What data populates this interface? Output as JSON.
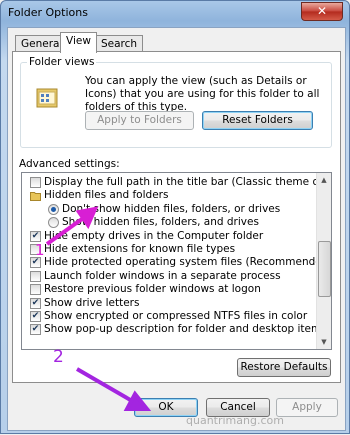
{
  "window": {
    "title": "Folder Options",
    "close_glyph": "✕"
  },
  "tabs": [
    {
      "label": "General"
    },
    {
      "label": "View"
    },
    {
      "label": "Search"
    }
  ],
  "folder_views": {
    "legend": "Folder views",
    "description": "You can apply the view (such as Details or Icons) that you are using for this folder to all folders of this type.",
    "apply_button": "Apply to Folders",
    "reset_button": "Reset Folders"
  },
  "advanced": {
    "label": "Advanced settings:",
    "items": [
      {
        "text": "Display the full path in the title bar (Classic theme only)",
        "kind": "checkbox",
        "checked": false,
        "indent": 1
      },
      {
        "text": "Hidden files and folders",
        "kind": "folder",
        "indent": 1
      },
      {
        "text": "Don't show hidden files, folders, or drives",
        "kind": "radio",
        "checked": true,
        "indent": 2
      },
      {
        "text": "Show hidden files, folders, and drives",
        "kind": "radio",
        "checked": false,
        "indent": 2
      },
      {
        "text": "Hide empty drives in the Computer folder",
        "kind": "checkbox",
        "checked": true,
        "indent": 1
      },
      {
        "text": "Hide extensions for known file types",
        "kind": "checkbox",
        "checked": false,
        "indent": 1
      },
      {
        "text": "Hide protected operating system files (Recommended)",
        "kind": "checkbox",
        "checked": true,
        "indent": 1
      },
      {
        "text": "Launch folder windows in a separate process",
        "kind": "checkbox",
        "checked": false,
        "indent": 1
      },
      {
        "text": "Restore previous folder windows at logon",
        "kind": "checkbox",
        "checked": false,
        "indent": 1
      },
      {
        "text": "Show drive letters",
        "kind": "checkbox",
        "checked": true,
        "indent": 1
      },
      {
        "text": "Show encrypted or compressed NTFS files in color",
        "kind": "checkbox",
        "checked": true,
        "indent": 1
      },
      {
        "text": "Show pop-up description for folder and desktop items",
        "kind": "checkbox",
        "checked": true,
        "indent": 1
      }
    ],
    "restore_button": "Restore Defaults"
  },
  "footer": {
    "ok": "OK",
    "cancel": "Cancel",
    "apply": "Apply"
  },
  "annotations": {
    "marker_1": "1",
    "marker_2": "2",
    "color": "#e21fd9"
  },
  "watermark": "quantrimang.com",
  "icons": {
    "check": "✔",
    "folder": "folder-icon",
    "arrow_up": "▲",
    "arrow_down": "▼"
  }
}
